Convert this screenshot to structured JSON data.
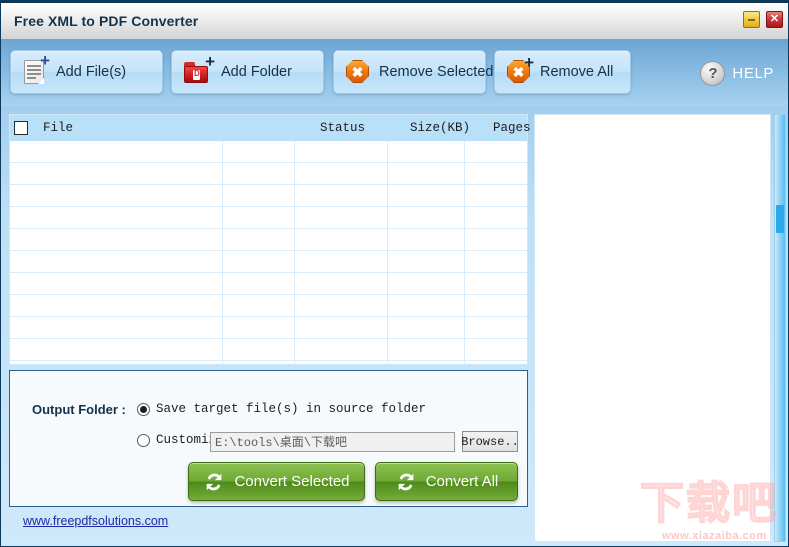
{
  "window": {
    "title": "Free XML to PDF Converter",
    "minimize_label": "–",
    "close_label": "✕"
  },
  "toolbar": {
    "buttons": [
      {
        "label": "Add File(s)",
        "icon": "document-plus-icon"
      },
      {
        "label": "Add Folder",
        "icon": "folder-plus-icon"
      },
      {
        "label": "Remove Selected",
        "icon": "remove-octagon-icon"
      },
      {
        "label": "Remove All",
        "icon": "remove-octagon-plus-icon"
      }
    ],
    "help": {
      "label": "HELP",
      "icon": "question-circle-icon"
    }
  },
  "file_list": {
    "select_all_checked": false,
    "columns": [
      {
        "key": "file",
        "label": "File"
      },
      {
        "key": "status",
        "label": "Status"
      },
      {
        "key": "size",
        "label": "Size(KB)"
      },
      {
        "key": "pages",
        "label": "Pages"
      }
    ],
    "rows": []
  },
  "output": {
    "label": "Output Folder :",
    "option_source": {
      "label": "Save target file(s) in source folder",
      "selected": true
    },
    "option_custom": {
      "label": "Customize",
      "selected": false
    },
    "path_value": "E:\\tools\\桌面\\下载吧",
    "browse_label": "Browse..",
    "convert_selected_label": "Convert Selected",
    "convert_all_label": "Convert All",
    "convert_icon": "refresh-arrows-icon"
  },
  "footer": {
    "link": "www.freepdfsolutions.com"
  },
  "watermark": {
    "text": "下载吧",
    "url": "www.xiazaiba.com"
  },
  "colors": {
    "accent_blue": "#6ba4d4",
    "panel_blue": "#b9e0f9",
    "convert_green": "#6faa34",
    "link_blue": "#1f28a8",
    "close_red": "#cc3b3b",
    "minimize_yellow": "#f2ce44"
  }
}
